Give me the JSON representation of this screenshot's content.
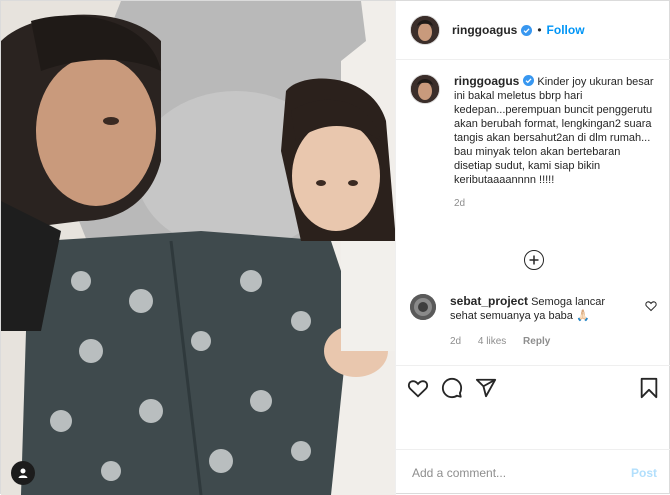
{
  "post": {
    "photo_alt": "",
    "author": {
      "username": "ringgoagus",
      "verified": true,
      "follow_label": "Follow",
      "separator": "•"
    },
    "caption": {
      "username": "ringgoagus",
      "text": "Kinder joy ukuran besar ini bakal meletus bbrp hari kedepan...perempuan buncit penggerutu akan berubah format, lengkingan2 suara tangis akan bersahut2an di dlm rumah... bau minyak telon akan bertebaran disetiap sudut, kami siap bikin keributaaaannnn !!!!!",
      "time": "2d"
    },
    "comments": [
      {
        "username": "sebat_project",
        "text": "Semoga lancar sehat semuanya ya baba 🙏🏻",
        "time": "2d",
        "likes": "4 likes",
        "reply_label": "Reply"
      }
    ],
    "add_comment": {
      "placeholder": "Add a comment...",
      "post_label": "Post"
    },
    "icons": {
      "like": "heart-icon",
      "comment": "comment-icon",
      "share": "share-icon",
      "save": "bookmark-icon",
      "more_comments": "plus-circle-icon",
      "verified": "verified-badge-icon",
      "user_tag": "user-tag-icon"
    },
    "colors": {
      "link": "#0095f6",
      "post_disabled": "#b2dffc",
      "secondary_text": "#8e8e8e",
      "border": "#dbdbdb"
    }
  }
}
